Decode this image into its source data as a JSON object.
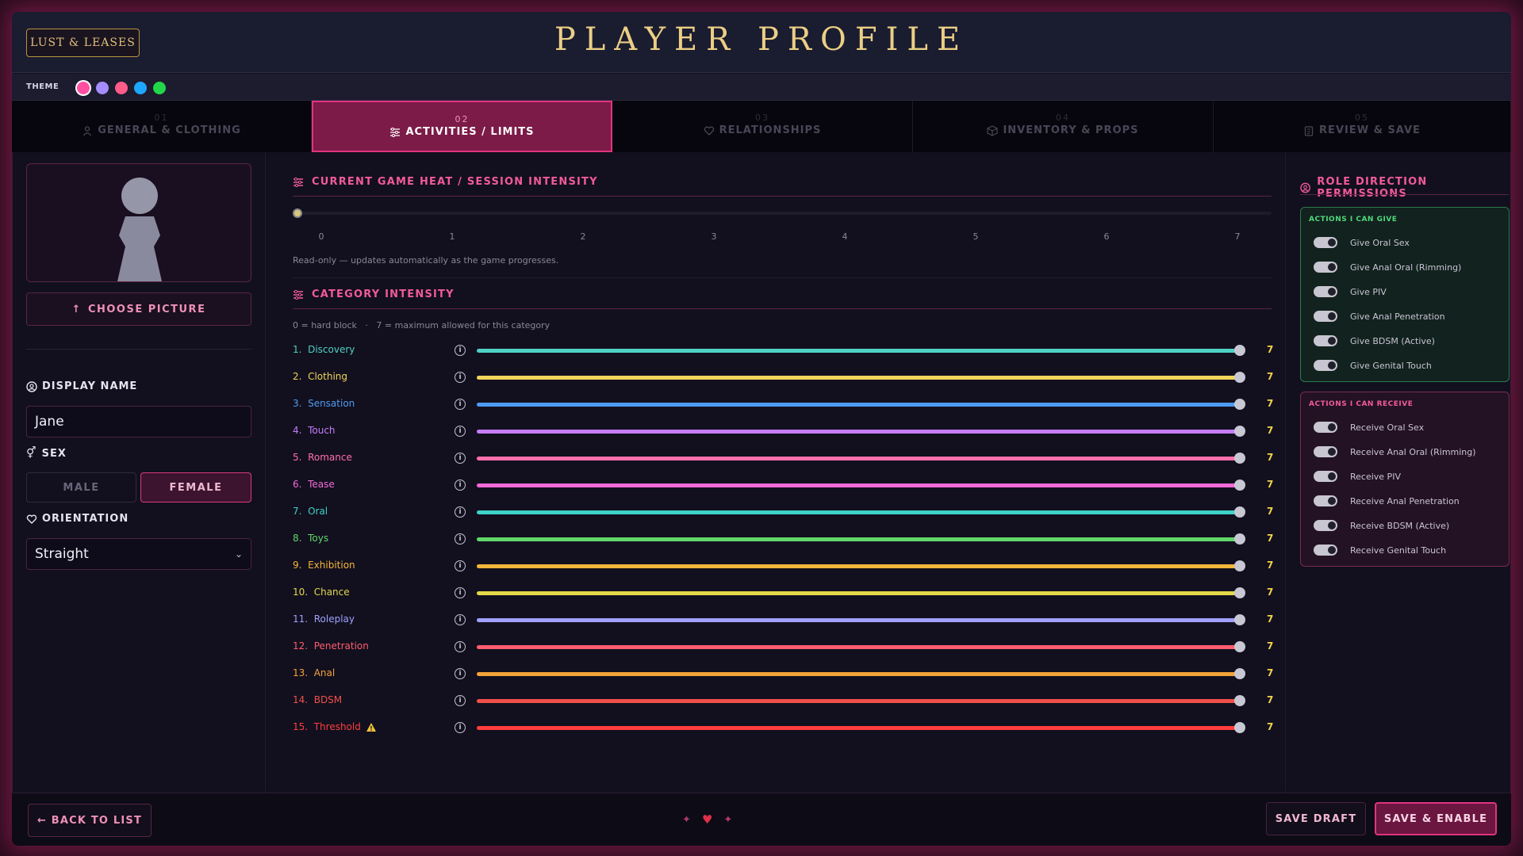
{
  "header": {
    "logo": "LUST & LEASES",
    "title": "PLAYER PROFILE"
  },
  "theme": {
    "label": "THEME",
    "swatches": [
      {
        "name": "pink",
        "color": "#ff4fa3",
        "active": true
      },
      {
        "name": "violet",
        "color": "#a58cff"
      },
      {
        "name": "rose",
        "color": "#ff5c8a"
      },
      {
        "name": "sky",
        "color": "#1ea7ff"
      },
      {
        "name": "green",
        "color": "#22d64a"
      }
    ]
  },
  "tabs": [
    {
      "num": "01",
      "label": "GENERAL & CLOTHING",
      "icon": "person-icon"
    },
    {
      "num": "02",
      "label": "ACTIVITIES / LIMITS",
      "icon": "sliders-icon",
      "active": true
    },
    {
      "num": "03",
      "label": "RELATIONSHIPS",
      "icon": "heart-icon"
    },
    {
      "num": "04",
      "label": "INVENTORY & PROPS",
      "icon": "box-icon"
    },
    {
      "num": "05",
      "label": "REVIEW & SAVE",
      "icon": "clipboard-icon"
    }
  ],
  "profile": {
    "choose_picture": "CHOOSE PICTURE",
    "display_name_label": "DISPLAY NAME",
    "display_name": "Jane",
    "sex_label": "SEX",
    "sex_options": [
      "MALE",
      "FEMALE"
    ],
    "sex_selected": "FEMALE",
    "orientation_label": "ORIENTATION",
    "orientation": "Straight"
  },
  "heat": {
    "title": "CURRENT GAME HEAT / SESSION INTENSITY",
    "ticks": [
      "0",
      "1",
      "2",
      "3",
      "4",
      "5",
      "6",
      "7"
    ],
    "value": 0,
    "note": "Read-only — updates automatically as the game progresses."
  },
  "category": {
    "title": "CATEGORY INTENSITY",
    "legend": "0 = hard block   ·   7 = maximum allowed for this category",
    "items": [
      {
        "label": "1.  Discovery",
        "value": 7,
        "color": "#4fd1c5"
      },
      {
        "label": "2.  Clothing",
        "value": 7,
        "color": "#f2d45a"
      },
      {
        "label": "3.  Sensation",
        "value": 7,
        "color": "#4e9cf2"
      },
      {
        "label": "4.  Touch",
        "value": 7,
        "color": "#c77dff"
      },
      {
        "label": "5.  Romance",
        "value": 7,
        "color": "#ff6fae"
      },
      {
        "label": "6.  Tease",
        "value": 7,
        "color": "#f26ad8"
      },
      {
        "label": "7.  Oral",
        "value": 7,
        "color": "#3ed3c8"
      },
      {
        "label": "8.  Toys",
        "value": 7,
        "color": "#5fd86a"
      },
      {
        "label": "9.  Exhibition",
        "value": 7,
        "color": "#f4b63a"
      },
      {
        "label": "10.  Chance",
        "value": 7,
        "color": "#e4d84a"
      },
      {
        "label": "11.  Roleplay",
        "value": 7,
        "color": "#a0a0ff"
      },
      {
        "label": "12.  Penetration",
        "value": 7,
        "color": "#ff5c6e"
      },
      {
        "label": "13.  Anal",
        "value": 7,
        "color": "#f4a23a"
      },
      {
        "label": "14.  BDSM",
        "value": 7,
        "color": "#f0504a"
      },
      {
        "label": "15.  Threshold",
        "value": 7,
        "color": "#ff3d3d",
        "warning": true
      }
    ]
  },
  "permissions": {
    "title": "ROLE DIRECTION PERMISSIONS",
    "give": {
      "title": "ACTIONS I CAN GIVE",
      "items": [
        "Give Oral Sex",
        "Give Anal Oral (Rimming)",
        "Give PIV",
        "Give Anal Penetration",
        "Give BDSM (Active)",
        "Give Genital Touch"
      ]
    },
    "receive": {
      "title": "ACTIONS I CAN RECEIVE",
      "items": [
        "Receive Oral Sex",
        "Receive Anal Oral (Rimming)",
        "Receive PIV",
        "Receive Anal Penetration",
        "Receive BDSM (Active)",
        "Receive Genital Touch"
      ]
    }
  },
  "footer": {
    "back": "← BACK TO LIST",
    "save_draft": "SAVE DRAFT",
    "save_enable": "SAVE & ENABLE"
  }
}
